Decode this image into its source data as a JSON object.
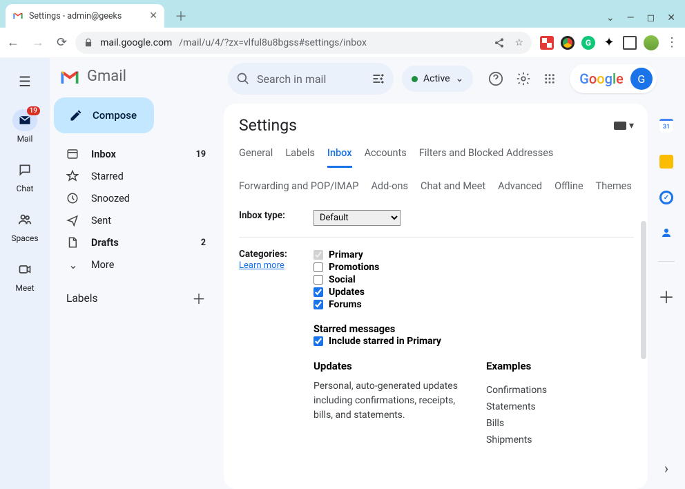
{
  "browser": {
    "tab_title": "Settings - admin@geeks",
    "url_host": "mail.google.com",
    "url_path": "/mail/u/4/?zx=vlful8u8bgss#settings/inbox"
  },
  "rail": {
    "items": [
      {
        "label": "Mail",
        "badge": "19"
      },
      {
        "label": "Chat"
      },
      {
        "label": "Spaces"
      },
      {
        "label": "Meet"
      }
    ]
  },
  "sidebar": {
    "product": "Gmail",
    "compose": "Compose",
    "folders": [
      {
        "label": "Inbox",
        "count": "19",
        "bold": true
      },
      {
        "label": "Starred"
      },
      {
        "label": "Snoozed"
      },
      {
        "label": "Sent"
      },
      {
        "label": "Drafts",
        "count": "2",
        "bold": true
      },
      {
        "label": "More"
      }
    ],
    "labels_heading": "Labels"
  },
  "search": {
    "placeholder": "Search in mail"
  },
  "status_pill": "Active",
  "google_initial": "G",
  "settings": {
    "title": "Settings",
    "tabs": [
      "General",
      "Labels",
      "Inbox",
      "Accounts",
      "Filters and Blocked Addresses",
      "Forwarding and POP/IMAP",
      "Add-ons",
      "Chat and Meet",
      "Advanced",
      "Offline",
      "Themes"
    ],
    "active_tab": "Inbox",
    "inbox_type_label": "Inbox type:",
    "inbox_type_value": "Default",
    "categories_label": "Categories:",
    "learn_more": "Learn more",
    "categories": [
      {
        "label": "Primary",
        "checked": true,
        "disabled": true
      },
      {
        "label": "Promotions",
        "checked": false
      },
      {
        "label": "Social",
        "checked": false
      },
      {
        "label": "Updates",
        "checked": true
      },
      {
        "label": "Forums",
        "checked": true
      }
    ],
    "starred_heading": "Starred messages",
    "starred_option": "Include starred in Primary",
    "starred_checked": true,
    "desc_heading": "Updates",
    "desc_text": "Personal, auto-generated updates including confirmations, receipts, bills, and statements.",
    "examples_heading": "Examples",
    "examples": [
      "Confirmations",
      "Statements",
      "Bills",
      "Shipments"
    ]
  }
}
